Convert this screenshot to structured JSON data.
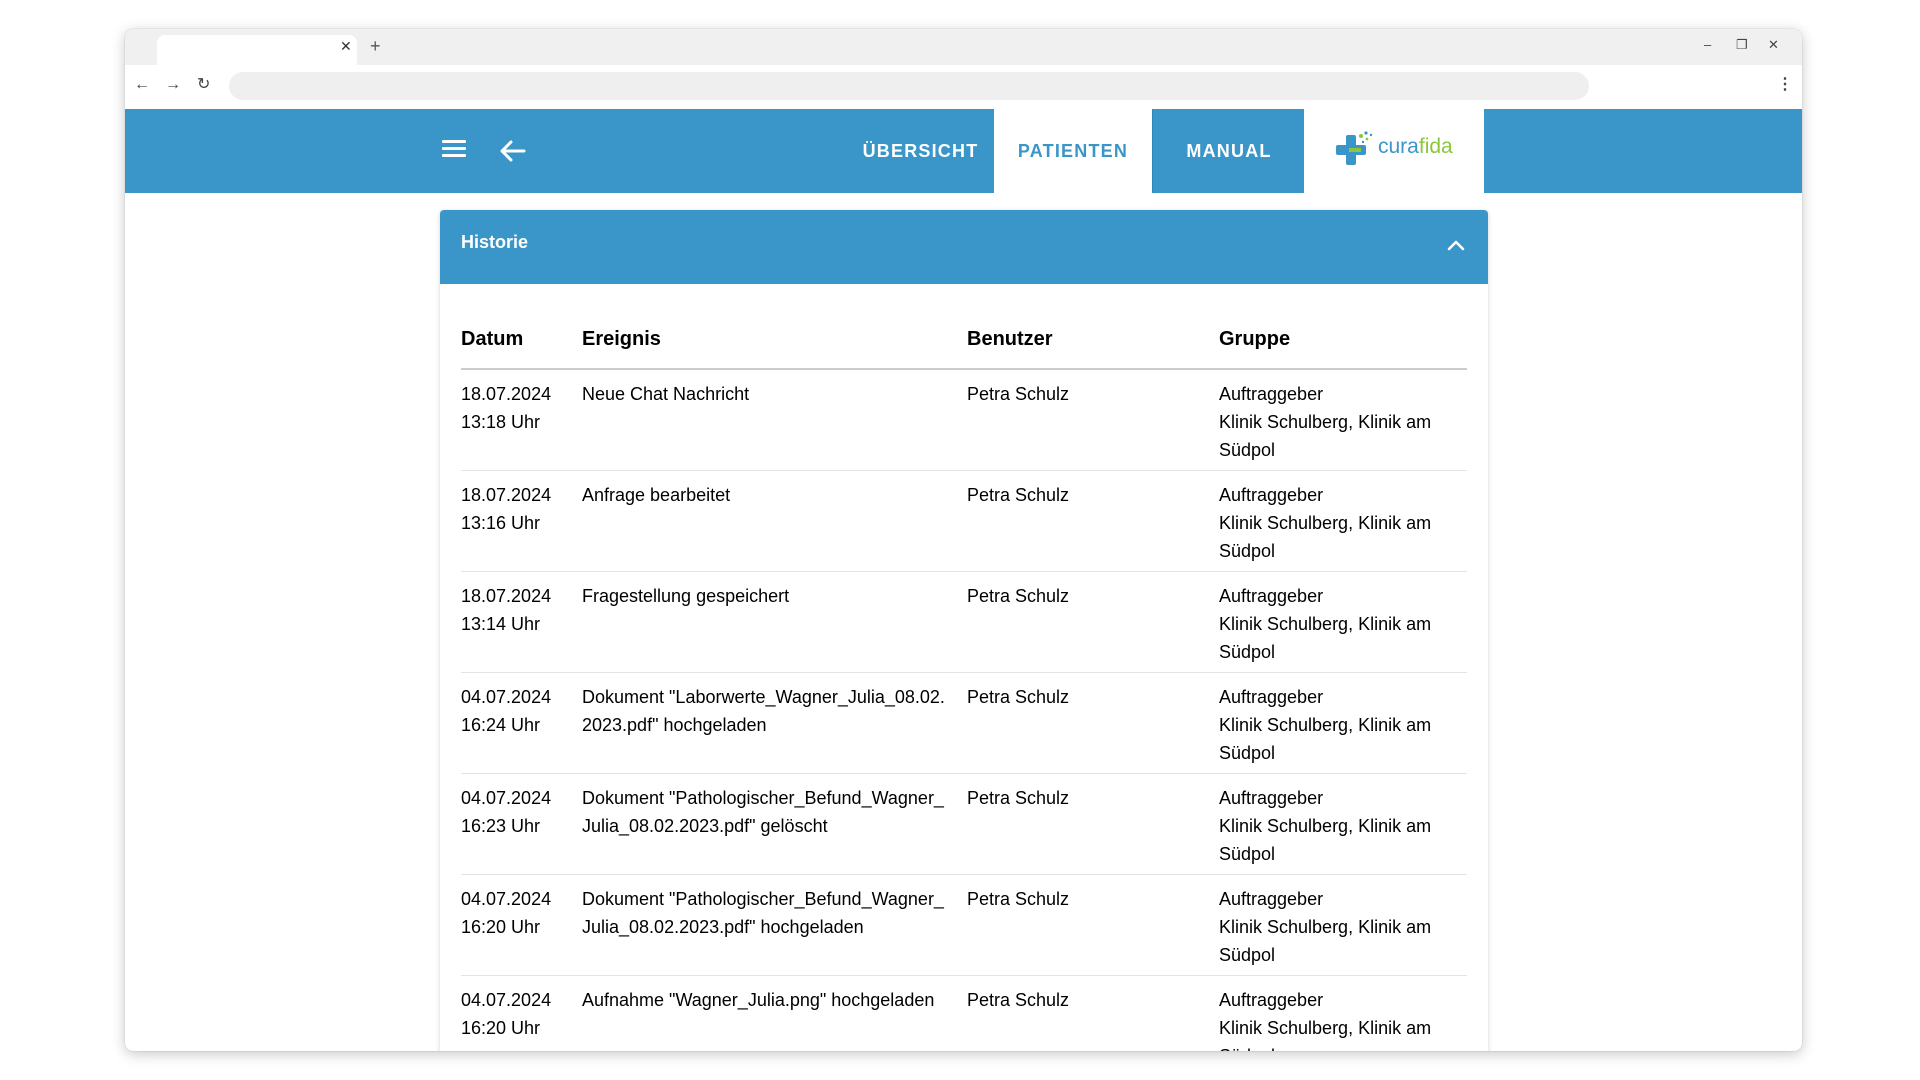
{
  "browser": {
    "tab_title": "",
    "new_tab_label": "+",
    "close_tab_label": "✕",
    "window_controls": {
      "minimize": "–",
      "restore": "❐",
      "close": "✕"
    },
    "nav": {
      "back": "←",
      "forward": "→",
      "reload": "↻"
    },
    "address_value": "",
    "menu_label": "⋮"
  },
  "header": {
    "nav_tabs": [
      {
        "label": "ÜBERSICHT"
      },
      {
        "label": "PATIENTEN"
      },
      {
        "label": "MANUAL"
      }
    ],
    "active_tab": "PATIENTEN",
    "logo": {
      "part1": "cura",
      "part2": "fida"
    }
  },
  "history": {
    "title": "Historie",
    "columns": [
      "Datum",
      "Ereignis",
      "Benutzer",
      "Gruppe"
    ],
    "rows": [
      {
        "date": "18.07.2024",
        "time": "13:18 Uhr",
        "event": "Neue Chat Nachricht",
        "user": "Petra Schulz",
        "group_role": "Auftraggeber",
        "group_name": "Klinik Schulberg, Klinik am Südpol"
      },
      {
        "date": "18.07.2024",
        "time": "13:16 Uhr",
        "event": "Anfrage bearbeitet",
        "user": "Petra Schulz",
        "group_role": "Auftraggeber",
        "group_name": "Klinik Schulberg, Klinik am Südpol"
      },
      {
        "date": "18.07.2024",
        "time": "13:14 Uhr",
        "event": "Fragestellung gespeichert",
        "user": "Petra Schulz",
        "group_role": "Auftraggeber",
        "group_name": "Klinik Schulberg, Klinik am Südpol"
      },
      {
        "date": "04.07.2024",
        "time": "16:24 Uhr",
        "event": "Dokument \"Laborwerte_Wagner_Julia_08.02.2023.pdf\" hochgeladen",
        "user": "Petra Schulz",
        "group_role": "Auftraggeber",
        "group_name": "Klinik Schulberg, Klinik am Südpol"
      },
      {
        "date": "04.07.2024",
        "time": "16:23 Uhr",
        "event": "Dokument \"Pathologischer_Befund_Wagner_Julia_08.02.2023.pdf\" gelöscht",
        "user": "Petra Schulz",
        "group_role": "Auftraggeber",
        "group_name": "Klinik Schulberg, Klinik am Südpol"
      },
      {
        "date": "04.07.2024",
        "time": "16:20 Uhr",
        "event": "Dokument \"Pathologischer_Befund_Wagner_Julia_08.02.2023.pdf\" hochgeladen",
        "user": "Petra Schulz",
        "group_role": "Auftraggeber",
        "group_name": "Klinik Schulberg, Klinik am Südpol"
      },
      {
        "date": "04.07.2024",
        "time": "16:20 Uhr",
        "event": "Aufnahme \"Wagner_Julia.png\" hochgeladen",
        "user": "Petra Schulz",
        "group_role": "Auftraggeber",
        "group_name": "Klinik Schulberg, Klinik am Südpol"
      }
    ]
  },
  "colors": {
    "primary": "#3a96c9",
    "logo_blue": "#3a96c9",
    "logo_green": "#8cc63f"
  },
  "icons": [
    "close-icon",
    "plus-icon",
    "minimize-icon",
    "restore-icon",
    "back-icon",
    "forward-icon",
    "reload-icon",
    "kebab-menu-icon",
    "hamburger-menu-icon",
    "back-arrow-icon",
    "chevron-up-icon",
    "logo-cross-icon"
  ]
}
